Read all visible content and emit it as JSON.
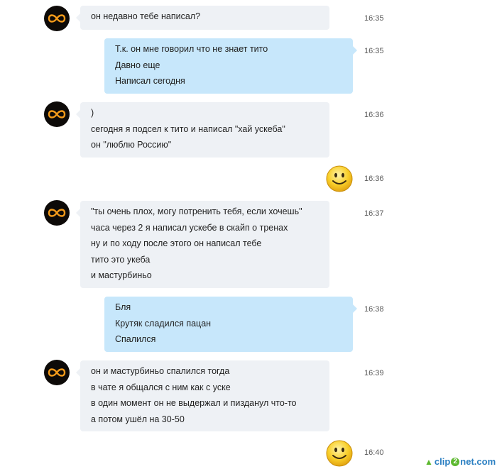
{
  "messages": [
    {
      "sender": "contact",
      "time": "16:35",
      "lines": [
        "он недавно тебе написал?"
      ]
    },
    {
      "sender": "me",
      "time": "16:35",
      "lines": [
        "Т.к. он мне говорил что не знает тито",
        "Давно еще",
        "Написал сегодня"
      ]
    },
    {
      "sender": "contact",
      "time": "16:36",
      "lines": [
        ")",
        "сегодня я подсел к тито и написал \"хай ускеба\"",
        "он \"люблю Россию\""
      ]
    },
    {
      "sender": "me",
      "time": "16:36",
      "emoticon": "smile-emoticon"
    },
    {
      "sender": "contact",
      "time": "16:37",
      "lines": [
        "\"ты очень плох, могу потренить тебя, если хочешь\"",
        "часа через 2 я написал ускебе в скайп о тренах",
        "ну и по ходу после этого он написал тебе",
        "тито это укеба",
        "и мастурбиньо"
      ]
    },
    {
      "sender": "me",
      "time": "16:38",
      "lines": [
        "Бля",
        "Крутяк сладился пацан",
        "Спалился"
      ]
    },
    {
      "sender": "contact",
      "time": "16:39",
      "lines": [
        "он и мастурбиньо спалился тогда",
        "в чате я общался с ним как с уске",
        "в один момент он не выдержал и пизданул что-то",
        "а потом ушёл на 30-50"
      ]
    },
    {
      "sender": "me",
      "time": "16:40",
      "emoticon": "smile-emoticon"
    }
  ],
  "avatar_icon": "infinity-icon",
  "colors": {
    "incoming_bubble": "#eef1f5",
    "outgoing_bubble": "#c7e7fb",
    "avatar_bg": "#0d0a08",
    "avatar_glow": "#f39a1a",
    "timestamp": "#5a5a5a"
  },
  "watermark": {
    "part1": "clip",
    "part2": "2",
    "part3": "net",
    "part4": ".com"
  }
}
